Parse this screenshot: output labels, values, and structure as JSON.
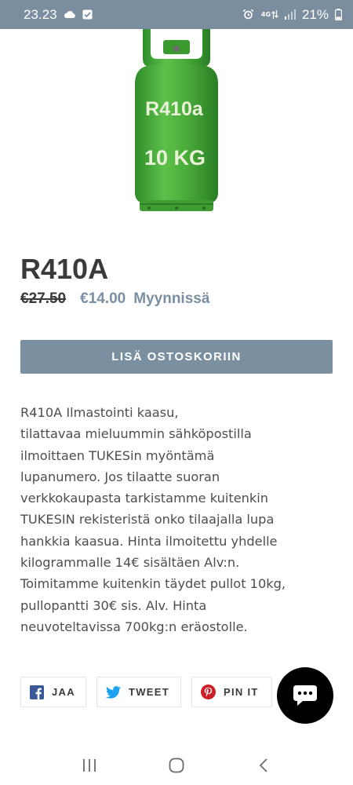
{
  "status_bar": {
    "time": "23.23",
    "network_top": "4G",
    "network_bottom": "",
    "battery": "21%",
    "icons": [
      "cloud-icon",
      "check-icon",
      "alarm-icon",
      "data-transfer-icon",
      "signal-icon",
      "battery-icon"
    ]
  },
  "product": {
    "image_label_top": "R410a",
    "image_label_bottom": "10 KG",
    "title": "R410A",
    "old_price": "€27.50",
    "new_price": "€14.00",
    "sale_label": "Myynnissä",
    "add_to_cart": "LISÄ OSTOSKORIIN",
    "description_lines": [
      "R410A Ilmastointi kaasu,",
      "tilattavaa mieluummin sähköpostilla",
      "ilmoittaen TUKESin myöntämä",
      "lupanumero. Jos tilaatte suoran",
      "verkkokaupasta tarkistamme kuitenkin",
      "TUKESIN rekisteristä onko tilaajalla lupa",
      "hankkia kaasua. Hinta ilmoitettu yhdelle",
      "kilogrammalle 14€ sisältäen Alv:n.",
      "Toimitamme kuitenkin täydet pullot 10kg,",
      "pullopantti 30€ sis. Alv. Hinta",
      "neuvoteltavissa 700kg:n eräostolle."
    ]
  },
  "share": {
    "facebook": "JAA",
    "twitter": "TWEET",
    "pinterest": "PIN IT"
  },
  "colors": {
    "status_bar": "#7a8ea0",
    "accent": "#7a8fa0",
    "cylinder_green": "#4caf3e",
    "facebook": "#3b5998",
    "twitter": "#1da1f2",
    "pinterest": "#cb2027"
  },
  "nav": {
    "icons": [
      "recents-icon",
      "home-icon",
      "back-icon"
    ]
  }
}
